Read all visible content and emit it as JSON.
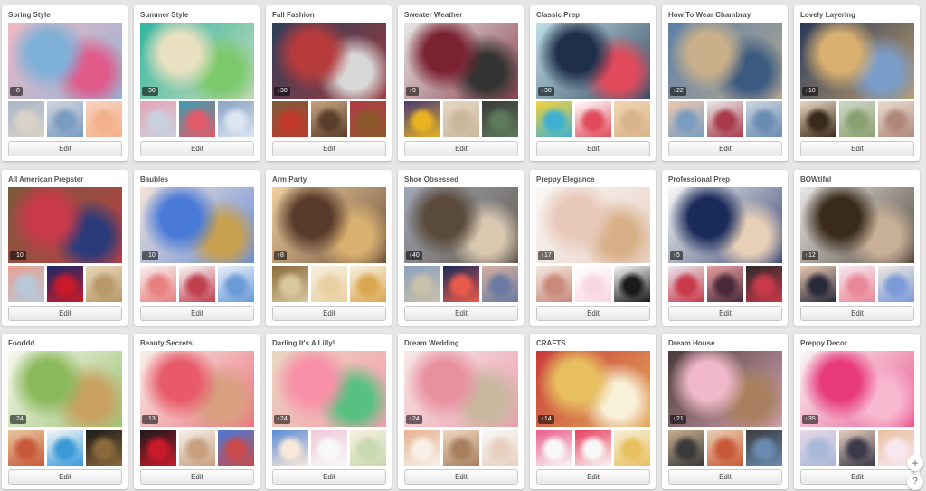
{
  "edit_label": "Edit",
  "pin_icon": "pin-icon",
  "boards": [
    {
      "title": "Spring Style",
      "count": "8",
      "colors": {
        "cover": [
          "#f1b9c4",
          "#7fb0d8",
          "#e05a8a"
        ],
        "thumbs": [
          [
            "#d9d2c8",
            "#a9b6c8"
          ],
          [
            "#7a9cc0",
            "#cfd5dd"
          ],
          [
            "#f3b08a",
            "#f6d2c0"
          ]
        ]
      }
    },
    {
      "title": "Summer Style",
      "count": "30",
      "colors": {
        "cover": [
          "#2fb7a0",
          "#e8e0c0",
          "#7bc96a"
        ],
        "thumbs": [
          [
            "#c8d0e0",
            "#e7a5b4"
          ],
          [
            "#e05a6a",
            "#3a9fb0"
          ],
          [
            "#dde6f2",
            "#8aa3c4"
          ]
        ]
      }
    },
    {
      "title": "Fall Fashion",
      "count": "30",
      "colors": {
        "cover": [
          "#2c3e5a",
          "#b73b3b",
          "#d8d8d8"
        ],
        "thumbs": [
          [
            "#c0392b",
            "#7b5c3c"
          ],
          [
            "#5a3e2b",
            "#c9a27e"
          ],
          [
            "#8b5a2b",
            "#b23a48"
          ]
        ]
      }
    },
    {
      "title": "Sweater Weather",
      "count": "9",
      "colors": {
        "cover": [
          "#e8e8e8",
          "#7a2232",
          "#333333"
        ],
        "thumbs": [
          [
            "#e9b323",
            "#4b3a72"
          ],
          [
            "#c9b79c",
            "#e6d7c3"
          ],
          [
            "#5d7a5a",
            "#3a3a3a"
          ]
        ]
      }
    },
    {
      "title": "Classic Prep",
      "count": "30",
      "colors": {
        "cover": [
          "#bfe0e8",
          "#1f2f4a",
          "#e04a5a"
        ],
        "thumbs": [
          [
            "#3fb0d0",
            "#f4d23c"
          ],
          [
            "#e04a5a",
            "#ffffff"
          ],
          [
            "#d9b48a",
            "#f0d6b0"
          ]
        ]
      }
    },
    {
      "title": "How To Wear Chambray",
      "count": "22",
      "colors": {
        "cover": [
          "#5a7fa8",
          "#c9b08a",
          "#3a5a80"
        ],
        "thumbs": [
          [
            "#7a9cc0",
            "#e8c8b0"
          ],
          [
            "#a83a4a",
            "#e8e8e8"
          ],
          [
            "#6a8cb0",
            "#c8d4e0"
          ]
        ]
      }
    },
    {
      "title": "Lovely Layering",
      "count": "10",
      "colors": {
        "cover": [
          "#2a3a5a",
          "#d9b070",
          "#7a9cc8"
        ],
        "thumbs": [
          [
            "#3a2a1a",
            "#e8d8c0"
          ],
          [
            "#8aa070",
            "#d0d8c8"
          ],
          [
            "#b0887a",
            "#e8dcd0"
          ]
        ]
      }
    },
    {
      "title": "All American Prepster",
      "count": "10",
      "colors": {
        "cover": [
          "#7a5a3a",
          "#c83a4a",
          "#2a3a7a"
        ],
        "thumbs": [
          [
            "#b8c8d8",
            "#e8a090"
          ],
          [
            "#c81a2a",
            "#1a2a6a"
          ],
          [
            "#b89868",
            "#e8d8b8"
          ]
        ]
      }
    },
    {
      "title": "Baubles",
      "count": "10",
      "colors": {
        "cover": [
          "#f4e4d8",
          "#4a7ad8",
          "#c8a050"
        ],
        "thumbs": [
          [
            "#e88080",
            "#f8f0f0"
          ],
          [
            "#c04050",
            "#f8f8f8"
          ],
          [
            "#6a9ad8",
            "#e8f0f8"
          ]
        ]
      }
    },
    {
      "title": "Arm Party",
      "count": "8",
      "colors": {
        "cover": [
          "#f0d0a0",
          "#5a3a2a",
          "#d8b070"
        ],
        "thumbs": [
          [
            "#d8c8a0",
            "#8a6a3a"
          ],
          [
            "#e8d0a0",
            "#f8f0e0"
          ],
          [
            "#d8a850",
            "#f8f0e0"
          ]
        ]
      }
    },
    {
      "title": "Shoe Obsessed",
      "count": "40",
      "colors": {
        "cover": [
          "#a0a8b8",
          "#5a4a3a",
          "#d8c8b0"
        ],
        "thumbs": [
          [
            "#c8c0a8",
            "#8aa0c0"
          ],
          [
            "#e85a4a",
            "#1a2a5a"
          ],
          [
            "#6a7aa0",
            "#d8b0a0"
          ]
        ]
      }
    },
    {
      "title": "Preppy Elegance",
      "count": "17",
      "colors": {
        "cover": [
          "#f8f8f8",
          "#e8c8b8",
          "#d8b088"
        ],
        "thumbs": [
          [
            "#c88a7a",
            "#f4e8e0"
          ],
          [
            "#f8d8e0",
            "#ffffff"
          ],
          [
            "#1a1a1a",
            "#f8f8f8"
          ]
        ]
      }
    },
    {
      "title": "Professional Prep",
      "count": "5",
      "colors": {
        "cover": [
          "#f8f8f8",
          "#1a2a5a",
          "#e8d0b8"
        ],
        "thumbs": [
          [
            "#c83a4a",
            "#e8e8f0"
          ],
          [
            "#4a2a3a",
            "#e8a0a0"
          ],
          [
            "#c83a4a",
            "#2a2a2a"
          ]
        ]
      }
    },
    {
      "title": "BOWtiful",
      "count": "12",
      "colors": {
        "cover": [
          "#e8e8e8",
          "#3a2a1a",
          "#c8b098"
        ],
        "thumbs": [
          [
            "#2a2a3a",
            "#e8c8b0"
          ],
          [
            "#e88898",
            "#f8e8f0"
          ],
          [
            "#7a9ad8",
            "#f0e8e0"
          ]
        ]
      }
    },
    {
      "title": "Fooddd",
      "count": "24",
      "colors": {
        "cover": [
          "#f8f8f0",
          "#8ab85a",
          "#c8a060"
        ],
        "thumbs": [
          [
            "#c85a3a",
            "#e8c8a0"
          ],
          [
            "#3a9ad8",
            "#f8f8f8"
          ],
          [
            "#8a6a3a",
            "#1a1a1a"
          ]
        ]
      }
    },
    {
      "title": "Beauty Secrets",
      "count": "13",
      "colors": {
        "cover": [
          "#f8f0e8",
          "#e85a6a",
          "#d8a080"
        ],
        "thumbs": [
          [
            "#c81a2a",
            "#1a1a1a"
          ],
          [
            "#c8a080",
            "#f8f0e8"
          ],
          [
            "#c84a4a",
            "#4a7ad8"
          ]
        ]
      }
    },
    {
      "title": "Darling It's A Lilly!",
      "count": "24",
      "colors": {
        "cover": [
          "#e8d8c0",
          "#f890a8",
          "#58c080"
        ],
        "thumbs": [
          [
            "#f8e8d8",
            "#5a8ad8"
          ],
          [
            "#f8f8f8",
            "#f0c8d8"
          ],
          [
            "#c8d8b0",
            "#f8f0e0"
          ]
        ]
      }
    },
    {
      "title": "Dream Wedding",
      "count": "24",
      "colors": {
        "cover": [
          "#f8e8e8",
          "#e890a0",
          "#c8b8a0"
        ],
        "thumbs": [
          [
            "#f8f0e8",
            "#e8b090"
          ],
          [
            "#a88060",
            "#f0d8c0"
          ],
          [
            "#e8d0c0",
            "#f8f8f8"
          ]
        ]
      }
    },
    {
      "title": "CRAFTS",
      "count": "14",
      "colors": {
        "cover": [
          "#c83a3a",
          "#e8c060",
          "#f8f0d8"
        ],
        "thumbs": [
          [
            "#f8f8f8",
            "#e85a8a"
          ],
          [
            "#f8f8f8",
            "#e83a5a"
          ],
          [
            "#e8c060",
            "#f8f0d8"
          ]
        ]
      }
    },
    {
      "title": "Dream House",
      "count": "21",
      "colors": {
        "cover": [
          "#4a3a3a",
          "#f0b8c8",
          "#a88060"
        ],
        "thumbs": [
          [
            "#3a3a3a",
            "#c8b090"
          ],
          [
            "#c85a3a",
            "#e8d0b0"
          ],
          [
            "#6a8ab0",
            "#3a3a3a"
          ]
        ]
      }
    },
    {
      "title": "Preppy Decor",
      "count": "35",
      "colors": {
        "cover": [
          "#f8f8f8",
          "#e83a7a",
          "#f8b8d0"
        ],
        "thumbs": [
          [
            "#a8b8d8",
            "#e8d8e8"
          ],
          [
            "#3a3a4a",
            "#e8d0c0"
          ],
          [
            "#f8e8f0",
            "#e8c0a0"
          ]
        ]
      }
    }
  ]
}
